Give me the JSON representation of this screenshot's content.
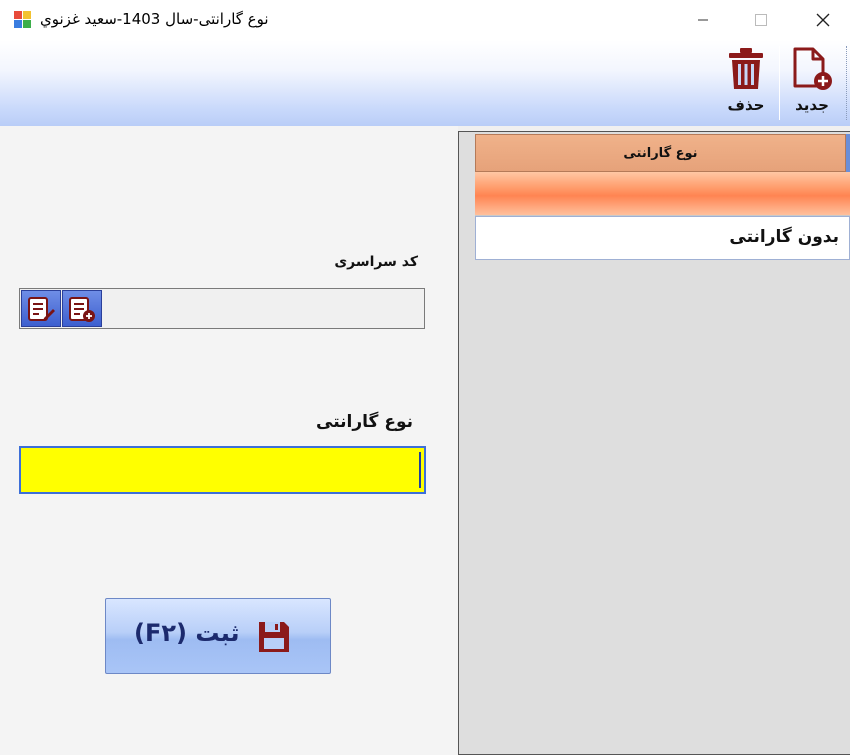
{
  "window": {
    "title": "نوع گارانتی-سال 1403-سعید غزنوي",
    "minimize_icon": "minimize-icon",
    "maximize_icon": "maximize-icon",
    "close_icon": "close-icon"
  },
  "toolbar": {
    "new_label": "جدید",
    "new_icon": "new-document-icon",
    "delete_label": "حذف",
    "delete_icon": "trash-icon",
    "icon_color": "#8b1a1a"
  },
  "form": {
    "code_label": "کد سراسری",
    "code_value": "",
    "type_label": "نوع گارانتی",
    "type_value": "",
    "type_field_color": "#ffff00",
    "save_label": "ثبت (F۲)",
    "save_icon": "floppy-disk-icon"
  },
  "grid": {
    "columns": [
      "نوع گارانتی"
    ],
    "header_color": "#e9a57d",
    "rows": [
      {
        "cells": [
          "بدون گارانتی"
        ]
      }
    ]
  }
}
